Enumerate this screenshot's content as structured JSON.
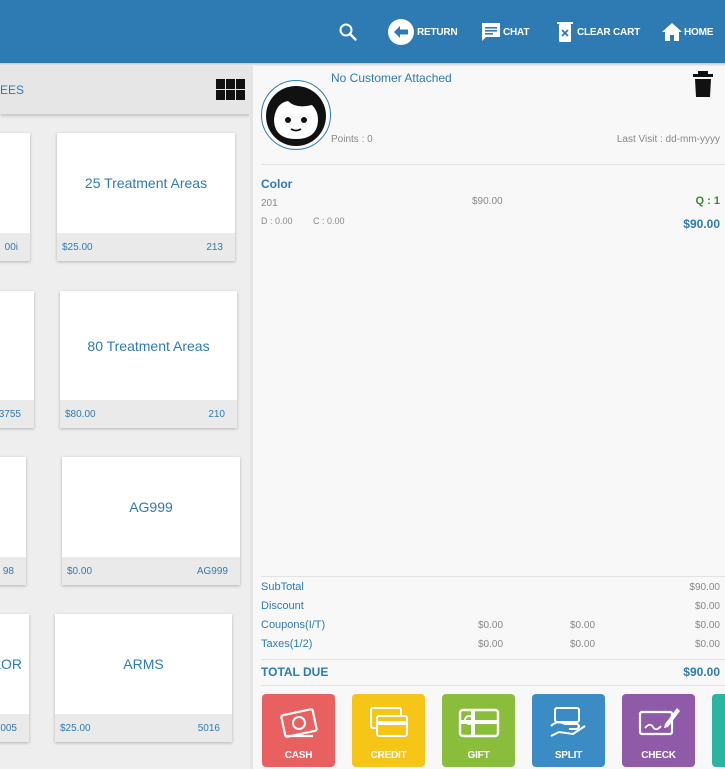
{
  "nav": {
    "return_label": "RETURN",
    "chat_label": "CHAT",
    "clear_cart_label": "CLEAR CART",
    "home_label": "HOME"
  },
  "category": {
    "label": "EES"
  },
  "tiles": [
    {
      "name": "",
      "price": "",
      "code": "00i"
    },
    {
      "name": "25 Treatment Areas",
      "price": "$25.00",
      "code": "213"
    },
    {
      "name": "",
      "price": "",
      "code": "3755"
    },
    {
      "name": "80 Treatment Areas",
      "price": "$80.00",
      "code": "210"
    },
    {
      "name": "",
      "price": "",
      "code": "98"
    },
    {
      "name": "AG999",
      "price": "$0.00",
      "code": "AG999"
    },
    {
      "name": "LOR",
      "price": "",
      "code": "005"
    },
    {
      "name": "ARMS",
      "price": "$25.00",
      "code": "5016"
    }
  ],
  "customer": {
    "name": "No Customer Attached",
    "points": "Points : 0",
    "last_visit": "Last Visit : dd-mm-yyyy"
  },
  "cart_item": {
    "name": "Color",
    "code": "201",
    "price": "$90.00",
    "qty": "Q : 1",
    "discount": "D : 0.00",
    "coupon": "C : 0.00",
    "total": "$90.00"
  },
  "summary": {
    "subtotal_label": "SubTotal",
    "subtotal": "$90.00",
    "discount_label": "Discount",
    "discount": "$0.00",
    "coupons_label": "Coupons(I/T)",
    "coupons_i": "$0.00",
    "coupons_t": "$0.00",
    "coupons_total": "$0.00",
    "taxes_label": "Taxes(1/2)",
    "taxes_1": "$0.00",
    "taxes_2": "$0.00",
    "taxes_total": "$0.00",
    "total_due_label": "TOTAL DUE",
    "total_due": "$90.00"
  },
  "payment": [
    {
      "label": "CASH",
      "color": "#e8605f"
    },
    {
      "label": "CREDIT",
      "color": "#f5c518"
    },
    {
      "label": "GIFT",
      "color": "#8bbd3c"
    },
    {
      "label": "SPLIT",
      "color": "#3b8cc4"
    },
    {
      "label": "CHECK",
      "color": "#8f5aa8"
    },
    {
      "label": "",
      "color": "#2bb5a0"
    }
  ]
}
